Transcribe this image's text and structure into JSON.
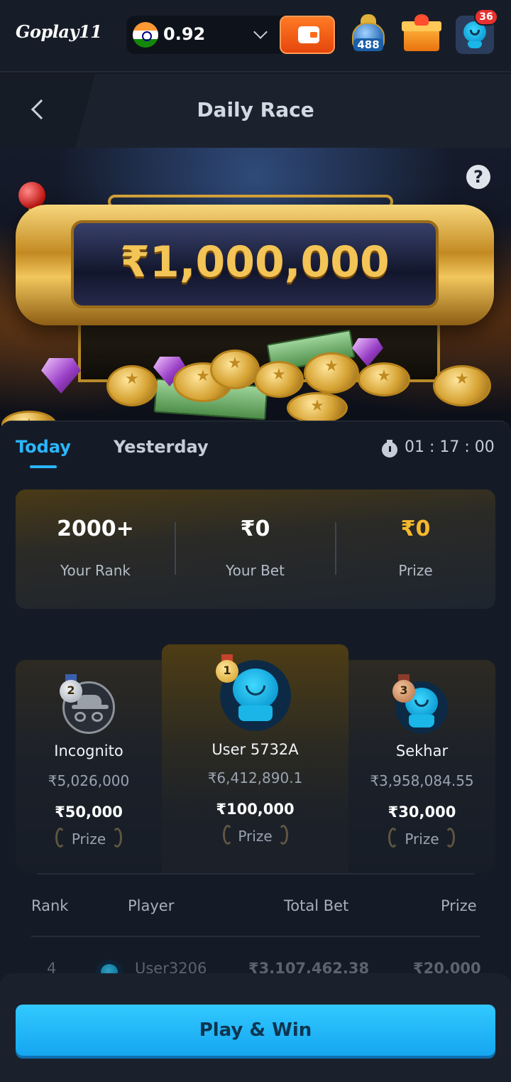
{
  "header": {
    "logo": "Goplay11",
    "balance": "0.92",
    "pot_count": "488",
    "notification_count": "36"
  },
  "title_bar": {
    "title": "Daily Race"
  },
  "banner": {
    "jackpot": "₹1,000,000",
    "help": "?"
  },
  "tabs": {
    "today": "Today",
    "yesterday": "Yesterday",
    "timer": "01 : 17 : 00"
  },
  "stats": [
    {
      "value": "2000+",
      "label": "Your Rank"
    },
    {
      "value": "₹0",
      "label": "Your Bet"
    },
    {
      "value": "₹0",
      "label": "Prize"
    }
  ],
  "podium": {
    "first": {
      "rank": "1",
      "name": "User 5732A",
      "bet": "₹6,412,890.1",
      "prize": "₹100,000",
      "prize_label": "Prize"
    },
    "second": {
      "rank": "2",
      "name": "Incognito",
      "bet": "₹5,026,000",
      "prize": "₹50,000",
      "prize_label": "Prize"
    },
    "third": {
      "rank": "3",
      "name": "Sekhar",
      "bet": "₹3,958,084.55",
      "prize": "₹30,000",
      "prize_label": "Prize"
    }
  },
  "table": {
    "headers": [
      "Rank",
      "Player",
      "Total Bet",
      "Prize"
    ],
    "partial_row": {
      "rank": "4",
      "player": "User3206",
      "total_bet": "₹3,107,462.38",
      "prize": "₹20,000"
    }
  },
  "cta": {
    "label": "Play & Win"
  },
  "colors": {
    "accent": "#2bb6ff",
    "gold": "#f5b82e",
    "cta": "#1ab3f5"
  }
}
